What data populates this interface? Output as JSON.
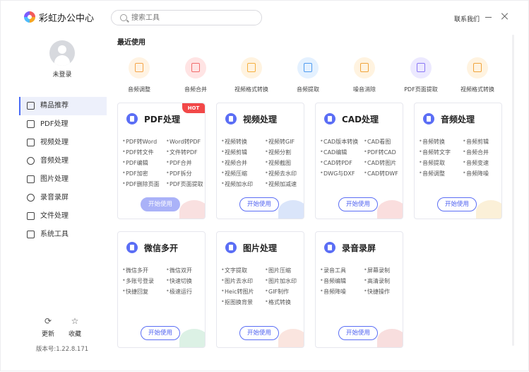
{
  "app": {
    "title": "彩虹办公中心",
    "contact_label": "联系我们"
  },
  "search": {
    "placeholder": "搜索工具"
  },
  "user": {
    "login_status": "未登录"
  },
  "sidebar": {
    "items": [
      {
        "label": "精品推荐",
        "icon": "thumbs-up-icon",
        "active": true
      },
      {
        "label": "PDF处理",
        "icon": "pdf-icon"
      },
      {
        "label": "视频处理",
        "icon": "video-icon"
      },
      {
        "label": "音频处理",
        "icon": "music-note-icon"
      },
      {
        "label": "图片处理",
        "icon": "image-icon"
      },
      {
        "label": "录音录屏",
        "icon": "record-icon"
      },
      {
        "label": "文件处理",
        "icon": "folder-icon"
      },
      {
        "label": "系统工具",
        "icon": "monitor-icon"
      }
    ],
    "update_label": "更新",
    "favorite_label": "收藏",
    "version": "版本号:1.22.8.171"
  },
  "main": {
    "recent_title": "最近使用",
    "recent": [
      {
        "label": "音频调整",
        "icon": "audio-adjust-icon",
        "bg": "#fff3e3",
        "fg": "#f5a54a"
      },
      {
        "label": "音频合并",
        "icon": "audio-merge-icon",
        "bg": "#ffe4e4",
        "fg": "#f26d6d"
      },
      {
        "label": "视频格式转换",
        "icon": "video-convert-icon",
        "bg": "#fff3e0",
        "fg": "#f5b040"
      },
      {
        "label": "音频提取",
        "icon": "audio-extract-icon",
        "bg": "#e4f1ff",
        "fg": "#4f9bf0"
      },
      {
        "label": "噪音消除",
        "icon": "noise-removal-icon",
        "bg": "#fff3e0",
        "fg": "#f0a43c"
      },
      {
        "label": "PDF页面提取",
        "icon": "pdf-extract-icon",
        "bg": "#ece9ff",
        "fg": "#8b78f5"
      },
      {
        "label": "视频格式转换",
        "icon": "video-convert-icon",
        "bg": "#fff3e0",
        "fg": "#f0a43c"
      }
    ],
    "cards": [
      {
        "title": "PDF处理",
        "icon": "pdf-icon",
        "hot": "HOT",
        "features": [
          "PDF转Word",
          "Word转PDF",
          "PDF转文件",
          "文件转PDF",
          "PDF编辑",
          "PDF合并",
          "PDF加密",
          "PDF拆分",
          "PDF删除页面",
          "PDF页面提取"
        ],
        "button": "开始使用",
        "deco": "#f4c6c6"
      },
      {
        "title": "视频处理",
        "icon": "video-icon",
        "features": [
          "视频转换",
          "视频转GIF",
          "视频剪辑",
          "视频分割",
          "视频合并",
          "视频截图",
          "视频压缩",
          "视频去水印",
          "视频加水印",
          "视频加减速"
        ],
        "button": "开始使用",
        "deco": "#bcd0f5"
      },
      {
        "title": "CAD处理",
        "icon": "cad-icon",
        "features": [
          "CAD版本转换",
          "CAD看图",
          "CAD编辑",
          "PDF转CAD",
          "CAD转PDF",
          "CAD转图片",
          "DWG与DXF",
          "CAD转DWF"
        ],
        "button": "开始使用",
        "deco": "#f5c2c2"
      },
      {
        "title": "音频处理",
        "icon": "music-note-icon",
        "features": [
          "音频转换",
          "音频剪辑",
          "音频转文字",
          "音频合并",
          "音频提取",
          "音频变速",
          "音频调整",
          "音频降噪"
        ],
        "button": "开始使用",
        "deco": "#f7e4b8"
      },
      {
        "title": "微信多开",
        "icon": "wechat-icon",
        "features": [
          "微信多开",
          "微信双开",
          "多账号登录",
          "快速切换",
          "快捷回复",
          "极速运行"
        ],
        "button": "开始使用",
        "deco": "#bfe6cf"
      },
      {
        "title": "图片处理",
        "icon": "image-icon",
        "features": [
          "文字提取",
          "图片压缩",
          "图片去水印",
          "图片加水印",
          "Heic转图片",
          "GIF制作",
          "抠图换背景",
          "格式转换"
        ],
        "button": "开始使用",
        "deco": "#f5cfc4"
      },
      {
        "title": "录音录屏",
        "icon": "microphone-icon",
        "features": [
          "录音工具",
          "屏幕录制",
          "音频编辑",
          "高清录制",
          "音频降噪",
          "快捷操作"
        ],
        "button": "开始使用",
        "deco": "#f2c3c3"
      }
    ]
  }
}
